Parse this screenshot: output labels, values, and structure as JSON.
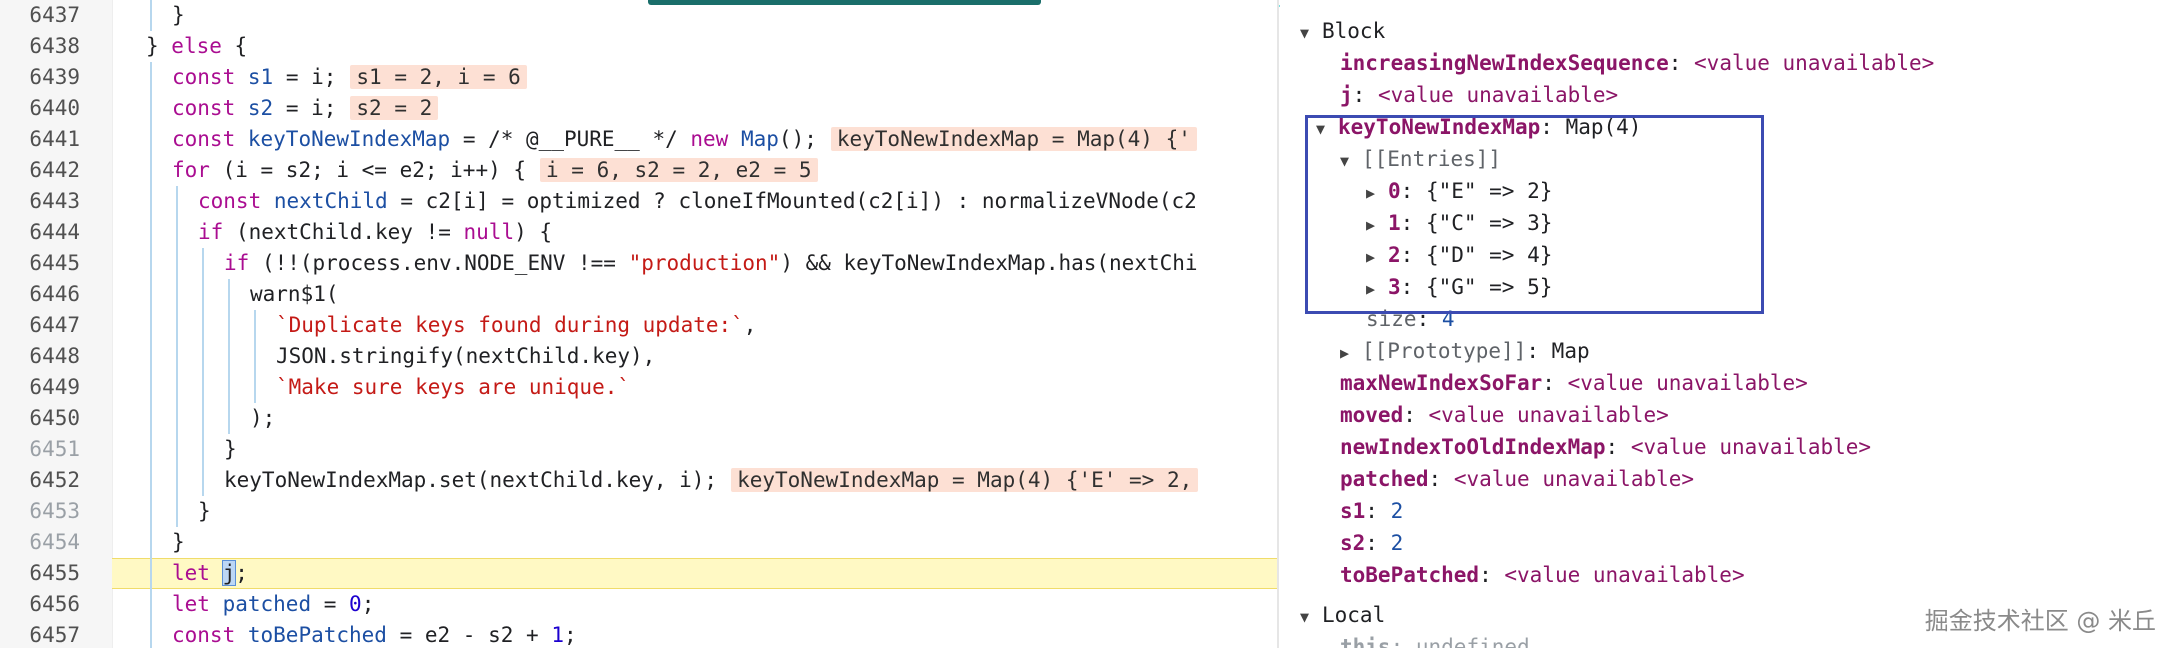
{
  "code_lines": [
    {
      "num": "6437",
      "dim": false,
      "indent": 2,
      "tokens": [
        {
          "t": "}",
          "c": "punct"
        }
      ]
    },
    {
      "num": "6438",
      "dim": false,
      "indent": 1,
      "tokens": [
        {
          "t": "} ",
          "c": "punct"
        },
        {
          "t": "else",
          "c": "kw"
        },
        {
          "t": " {",
          "c": "punct"
        }
      ]
    },
    {
      "num": "6439",
      "dim": false,
      "indent": 2,
      "tokens": [
        {
          "t": "const",
          "c": "kw"
        },
        {
          "t": " ",
          "c": "punct"
        },
        {
          "t": "s1",
          "c": "blue"
        },
        {
          "t": " = i;",
          "c": "punct"
        }
      ],
      "inline": "s1 = 2, i = 6"
    },
    {
      "num": "6440",
      "dim": false,
      "indent": 2,
      "tokens": [
        {
          "t": "const",
          "c": "kw"
        },
        {
          "t": " ",
          "c": "punct"
        },
        {
          "t": "s2",
          "c": "blue"
        },
        {
          "t": " = i;",
          "c": "punct"
        }
      ],
      "inline": "s2 = 2"
    },
    {
      "num": "6441",
      "dim": false,
      "indent": 2,
      "tokens": [
        {
          "t": "const",
          "c": "kw"
        },
        {
          "t": " ",
          "c": "punct"
        },
        {
          "t": "keyToNewIndexMap",
          "c": "blue"
        },
        {
          "t": " = /* @__PURE__ */ ",
          "c": "punct"
        },
        {
          "t": "new",
          "c": "kw"
        },
        {
          "t": " ",
          "c": "punct"
        },
        {
          "t": "Map",
          "c": "blue"
        },
        {
          "t": "();",
          "c": "punct"
        }
      ],
      "inline": "keyToNewIndexMap = Map(4) {'"
    },
    {
      "num": "6442",
      "dim": false,
      "indent": 2,
      "tokens": [
        {
          "t": "for",
          "c": "kw"
        },
        {
          "t": " (i = s2; i <= e2; i++) {",
          "c": "punct"
        }
      ],
      "inline": "i = 6, s2 = 2, e2 = 5"
    },
    {
      "num": "6443",
      "dim": false,
      "indent": 3,
      "tokens": [
        {
          "t": "const",
          "c": "kw"
        },
        {
          "t": " ",
          "c": "punct"
        },
        {
          "t": "nextChild",
          "c": "blue"
        },
        {
          "t": " = c2[i] = optimized ? cloneIfMounted(c2[i]) : normalizeVNode(c2",
          "c": "punct"
        }
      ]
    },
    {
      "num": "6444",
      "dim": false,
      "indent": 3,
      "tokens": [
        {
          "t": "if",
          "c": "kw"
        },
        {
          "t": " (nextChild.key != ",
          "c": "punct"
        },
        {
          "t": "null",
          "c": "kw"
        },
        {
          "t": ") {",
          "c": "punct"
        }
      ]
    },
    {
      "num": "6445",
      "dim": false,
      "indent": 4,
      "tokens": [
        {
          "t": "if",
          "c": "kw"
        },
        {
          "t": " (!!(process.env.NODE_ENV !== ",
          "c": "punct"
        },
        {
          "t": "\"production\"",
          "c": "str"
        },
        {
          "t": ") && keyToNewIndexMap.has(nextChi",
          "c": "punct"
        }
      ]
    },
    {
      "num": "6446",
      "dim": false,
      "indent": 5,
      "tokens": [
        {
          "t": "warn$1(",
          "c": "punct"
        }
      ]
    },
    {
      "num": "6447",
      "dim": false,
      "indent": 6,
      "tokens": [
        {
          "t": "`Duplicate keys found during update:`",
          "c": "str"
        },
        {
          "t": ",",
          "c": "punct"
        }
      ]
    },
    {
      "num": "6448",
      "dim": false,
      "indent": 6,
      "tokens": [
        {
          "t": "JSON.stringify(nextChild.key),",
          "c": "punct"
        }
      ]
    },
    {
      "num": "6449",
      "dim": false,
      "indent": 6,
      "tokens": [
        {
          "t": "`Make sure keys are unique.`",
          "c": "str"
        }
      ]
    },
    {
      "num": "6450",
      "dim": false,
      "indent": 5,
      "tokens": [
        {
          "t": ");",
          "c": "punct"
        }
      ]
    },
    {
      "num": "6451",
      "dim": true,
      "indent": 4,
      "tokens": [
        {
          "t": "}",
          "c": "punct"
        }
      ]
    },
    {
      "num": "6452",
      "dim": false,
      "indent": 4,
      "tokens": [
        {
          "t": "keyToNewIndexMap.set(nextChild.key, i);",
          "c": "punct"
        }
      ],
      "inline": "keyToNewIndexMap = Map(4) {'E' => 2,"
    },
    {
      "num": "6453",
      "dim": true,
      "indent": 3,
      "tokens": [
        {
          "t": "}",
          "c": "punct"
        }
      ]
    },
    {
      "num": "6454",
      "dim": true,
      "indent": 2,
      "tokens": [
        {
          "t": "}",
          "c": "punct"
        }
      ]
    },
    {
      "num": "6455",
      "dim": false,
      "indent": 2,
      "current": true,
      "tokens": [
        {
          "t": "let",
          "c": "kw"
        },
        {
          "t": " ",
          "c": "punct"
        },
        {
          "t": "j",
          "c": "sel"
        },
        {
          "t": ";",
          "c": "punct"
        }
      ]
    },
    {
      "num": "6456",
      "dim": false,
      "indent": 2,
      "tokens": [
        {
          "t": "let",
          "c": "kw"
        },
        {
          "t": " ",
          "c": "punct"
        },
        {
          "t": "patched",
          "c": "blue"
        },
        {
          "t": " = ",
          "c": "punct"
        },
        {
          "t": "0",
          "c": "num"
        },
        {
          "t": ";",
          "c": "punct"
        }
      ]
    },
    {
      "num": "6457",
      "dim": false,
      "indent": 2,
      "tokens": [
        {
          "t": "const",
          "c": "kw"
        },
        {
          "t": " ",
          "c": "punct"
        },
        {
          "t": "toBePatched",
          "c": "blue"
        },
        {
          "t": " = e2 - s2 + ",
          "c": "punct"
        },
        {
          "t": "1",
          "c": "num"
        },
        {
          "t": ";",
          "c": "punct"
        }
      ]
    }
  ],
  "scope": {
    "block_label": "Block",
    "local_label": "Local",
    "rows": [
      {
        "level": 1,
        "arrow": "",
        "name": "increasingNewIndexSequence",
        "value": "<value unavailable>",
        "vclass": "unavail"
      },
      {
        "level": 1,
        "arrow": "",
        "name": "j",
        "value": "<value unavailable>",
        "vclass": "unavail"
      },
      {
        "level": 1,
        "arrow": "down",
        "name": "keyToNewIndexMap",
        "value": "Map(4)",
        "vclass": "punct"
      },
      {
        "level": 2,
        "arrow": "down",
        "name": "[[Entries]]",
        "value": "",
        "vclass": "meta",
        "meta": true
      },
      {
        "level": 3,
        "arrow": "right",
        "name": "0",
        "value": "{\"E\" => 2}",
        "vclass": "punct"
      },
      {
        "level": 3,
        "arrow": "right",
        "name": "1",
        "value": "{\"C\" => 3}",
        "vclass": "punct"
      },
      {
        "level": 3,
        "arrow": "right",
        "name": "2",
        "value": "{\"D\" => 4}",
        "vclass": "punct"
      },
      {
        "level": 3,
        "arrow": "right",
        "name": "3",
        "value": "{\"G\" => 5}",
        "vclass": "punct"
      },
      {
        "level": 2,
        "arrow": "",
        "name": "size",
        "value": "4",
        "vclass": "tnum",
        "meta": true
      },
      {
        "level": 2,
        "arrow": "right",
        "name": "[[Prototype]]",
        "value": "Map",
        "vclass": "punct",
        "meta": true
      },
      {
        "level": 1,
        "arrow": "",
        "name": "maxNewIndexSoFar",
        "value": "<value unavailable>",
        "vclass": "unavail"
      },
      {
        "level": 1,
        "arrow": "",
        "name": "moved",
        "value": "<value unavailable>",
        "vclass": "unavail"
      },
      {
        "level": 1,
        "arrow": "",
        "name": "newIndexToOldIndexMap",
        "value": "<value unavailable>",
        "vclass": "unavail"
      },
      {
        "level": 1,
        "arrow": "",
        "name": "patched",
        "value": "<value unavailable>",
        "vclass": "unavail"
      },
      {
        "level": 1,
        "arrow": "",
        "name": "s1",
        "value": "2",
        "vclass": "tnum"
      },
      {
        "level": 1,
        "arrow": "",
        "name": "s2",
        "value": "2",
        "vclass": "tnum"
      },
      {
        "level": 1,
        "arrow": "",
        "name": "toBePatched",
        "value": "<value unavailable>",
        "vclass": "unavail"
      }
    ],
    "local_rows": [
      {
        "name": "this",
        "value": "undefined"
      }
    ]
  },
  "watermark": "掘金技术社区 @ 米丘"
}
